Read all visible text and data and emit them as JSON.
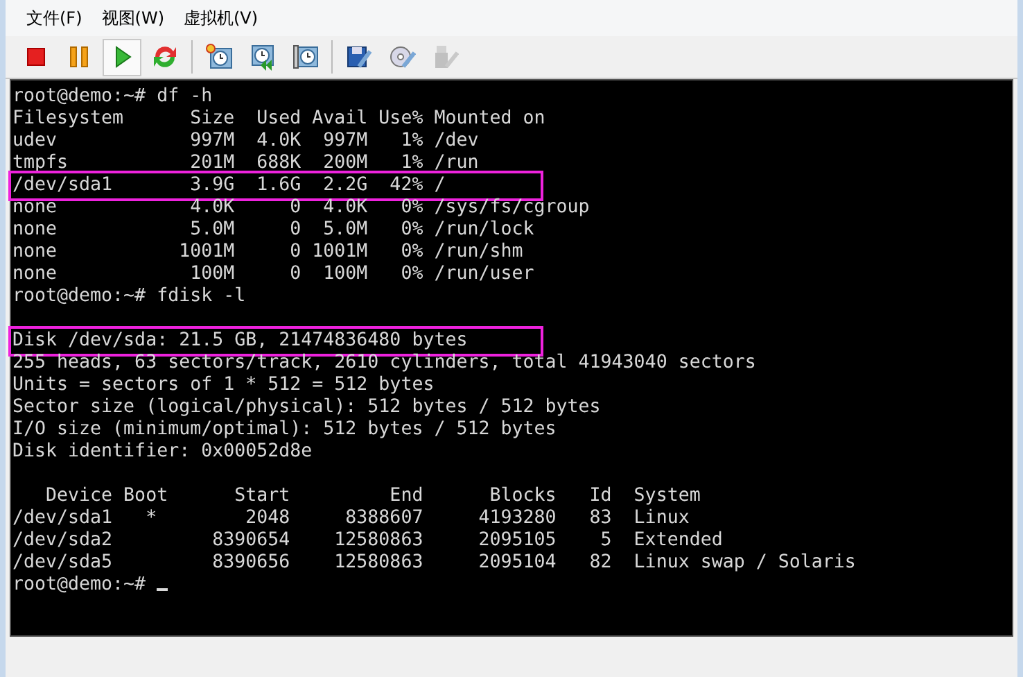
{
  "menu": [
    {
      "label": "文件(F)"
    },
    {
      "label": "视图(W)"
    },
    {
      "label": "虚拟机(V)"
    }
  ],
  "toolbar": [
    [
      {
        "kind": "stop",
        "selected": false,
        "disabled": false
      },
      {
        "kind": "pause",
        "selected": false,
        "disabled": false
      },
      {
        "kind": "play",
        "selected": true,
        "disabled": false
      },
      {
        "kind": "reset",
        "selected": false,
        "disabled": false
      }
    ],
    [
      {
        "kind": "snapshot-take",
        "selected": false,
        "disabled": false
      },
      {
        "kind": "snapshot-restore",
        "selected": false,
        "disabled": false
      },
      {
        "kind": "snapshot-manage",
        "selected": false,
        "disabled": false
      }
    ],
    [
      {
        "kind": "disk-settings",
        "selected": false,
        "disabled": false
      },
      {
        "kind": "cd-settings",
        "selected": false,
        "disabled": false
      },
      {
        "kind": "usb-settings",
        "selected": false,
        "disabled": true
      }
    ]
  ],
  "terminal": {
    "lines": [
      {
        "kind": "line",
        "text": "root@demo:~# df -h",
        "highlighted": false
      },
      {
        "kind": "line",
        "text": "Filesystem      Size  Used Avail Use% Mounted on",
        "highlighted": false
      },
      {
        "kind": "line",
        "text": "udev            997M  4.0K  997M   1% /dev",
        "highlighted": false
      },
      {
        "kind": "line",
        "text": "tmpfs           201M  688K  200M   1% /run",
        "highlighted": false
      },
      {
        "kind": "line",
        "text": "/dev/sda1       3.9G  1.6G  2.2G  42% /",
        "highlighted": true
      },
      {
        "kind": "line",
        "text": "none            4.0K     0  4.0K   0% /sys/fs/cgroup",
        "highlighted": false
      },
      {
        "kind": "line",
        "text": "none            5.0M     0  5.0M   0% /run/lock",
        "highlighted": false
      },
      {
        "kind": "line",
        "text": "none           1001M     0 1001M   0% /run/shm",
        "highlighted": false
      },
      {
        "kind": "line",
        "text": "none            100M     0  100M   0% /run/user",
        "highlighted": false
      },
      {
        "kind": "line",
        "text": "root@demo:~# fdisk -l",
        "highlighted": false
      },
      {
        "kind": "blank"
      },
      {
        "kind": "line",
        "text": "Disk /dev/sda: 21.5 GB, 21474836480 bytes",
        "highlighted": true
      },
      {
        "kind": "line",
        "text": "255 heads, 63 sectors/track, 2610 cylinders, total 41943040 sectors",
        "highlighted": false
      },
      {
        "kind": "line",
        "text": "Units = sectors of 1 * 512 = 512 bytes",
        "highlighted": false
      },
      {
        "kind": "line",
        "text": "Sector size (logical/physical): 512 bytes / 512 bytes",
        "highlighted": false
      },
      {
        "kind": "line",
        "text": "I/O size (minimum/optimal): 512 bytes / 512 bytes",
        "highlighted": false
      },
      {
        "kind": "line",
        "text": "Disk identifier: 0x00052d8e",
        "highlighted": false
      },
      {
        "kind": "blank"
      },
      {
        "kind": "line",
        "text": "   Device Boot      Start         End      Blocks   Id  System",
        "highlighted": false
      },
      {
        "kind": "line",
        "text": "/dev/sda1   *        2048     8388607     4193280   83  Linux",
        "highlighted": false
      },
      {
        "kind": "line",
        "text": "/dev/sda2         8390654    12580863     2095105    5  Extended",
        "highlighted": false
      },
      {
        "kind": "line",
        "text": "/dev/sda5         8390656    12580863     2095104   82  Linux swap / Solaris",
        "highlighted": false
      },
      {
        "kind": "prompt",
        "text": "root@demo:~#",
        "cursor": true
      }
    ]
  }
}
